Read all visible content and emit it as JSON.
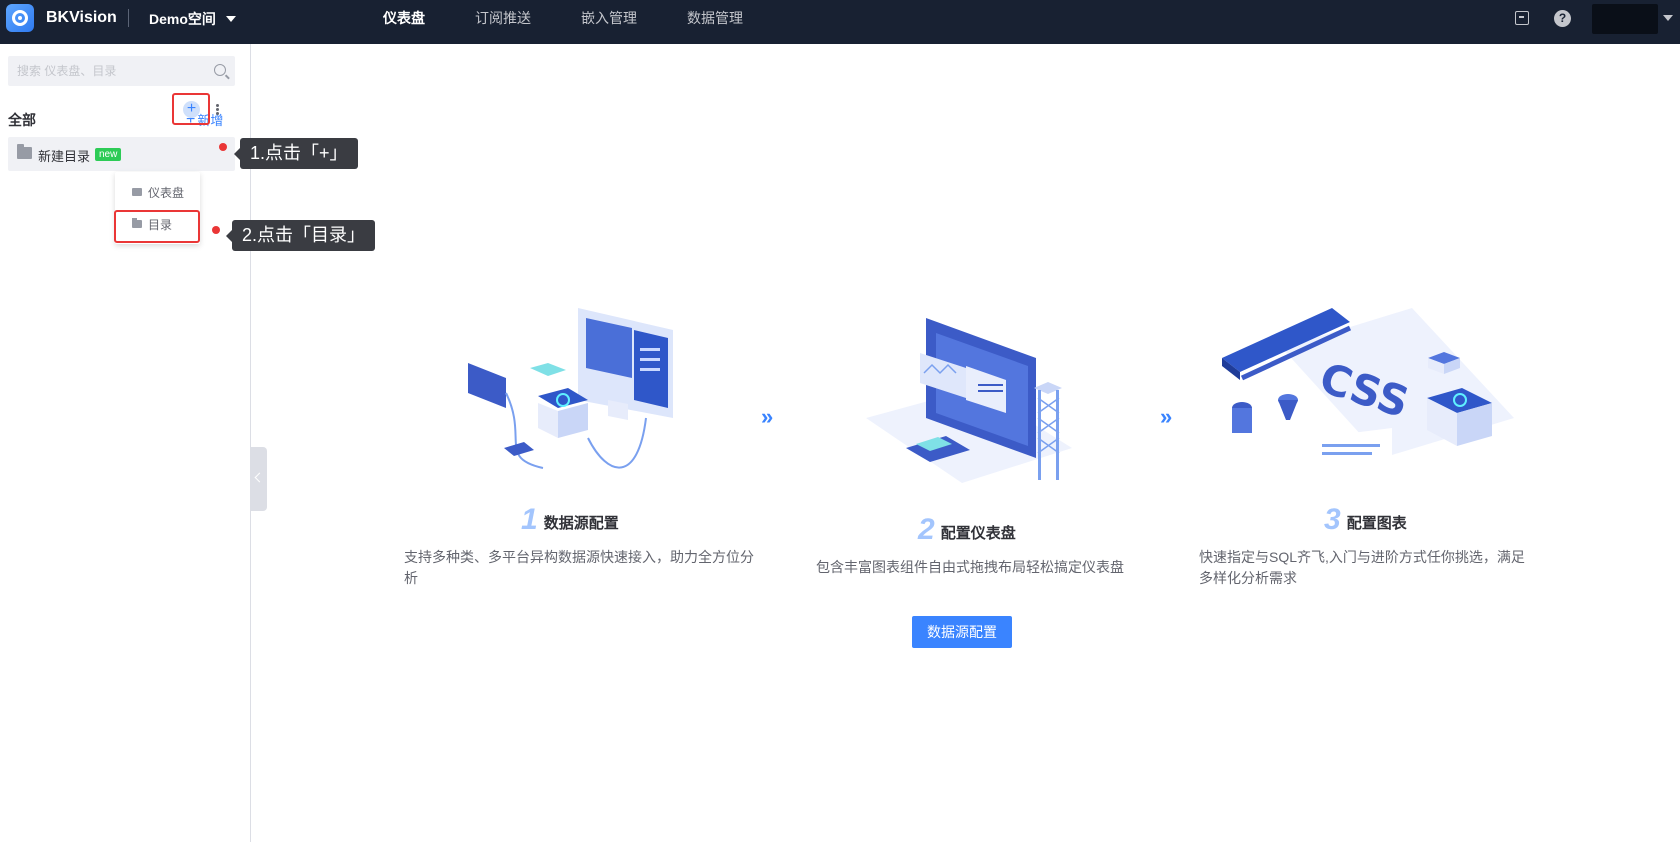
{
  "header": {
    "brand": "BKVision",
    "space": "Demo空间",
    "nav": [
      {
        "label": "仪表盘",
        "active": true
      },
      {
        "label": "订阅推送",
        "active": false
      },
      {
        "label": "嵌入管理",
        "active": false
      },
      {
        "label": "数据管理",
        "active": false
      }
    ],
    "help_glyph": "?"
  },
  "sidebar": {
    "search_placeholder": "搜索 仪表盘、目录",
    "section_title": "全部",
    "add_new": "新增",
    "directory": {
      "label": "新建目录",
      "badge": "new"
    },
    "dropdown": [
      {
        "label": "仪表盘",
        "icon": "dashboard-icon"
      },
      {
        "label": "目录",
        "icon": "folder-icon"
      }
    ]
  },
  "annotations": {
    "tip1": "1.点击「+」",
    "tip2": "2.点击「目录」"
  },
  "guide": {
    "steps": [
      {
        "num": "1",
        "title": "数据源配置",
        "desc": "支持多种类、多平台异构数据源快速接入，助力全方位分析"
      },
      {
        "num": "2",
        "title": "配置仪表盘",
        "desc": "包含丰富图表组件自由式拖拽布局轻松搞定仪表盘"
      },
      {
        "num": "3",
        "title": "配置图表",
        "desc": "快速指定与SQL齐飞,入门与进阶方式任你挑选，满足多样化分析需求"
      }
    ],
    "arrow_glyph": "»",
    "button": "数据源配置"
  },
  "colors": {
    "topbar": "#182132",
    "primary": "#3a84ff",
    "highlight": "#ea3636"
  }
}
